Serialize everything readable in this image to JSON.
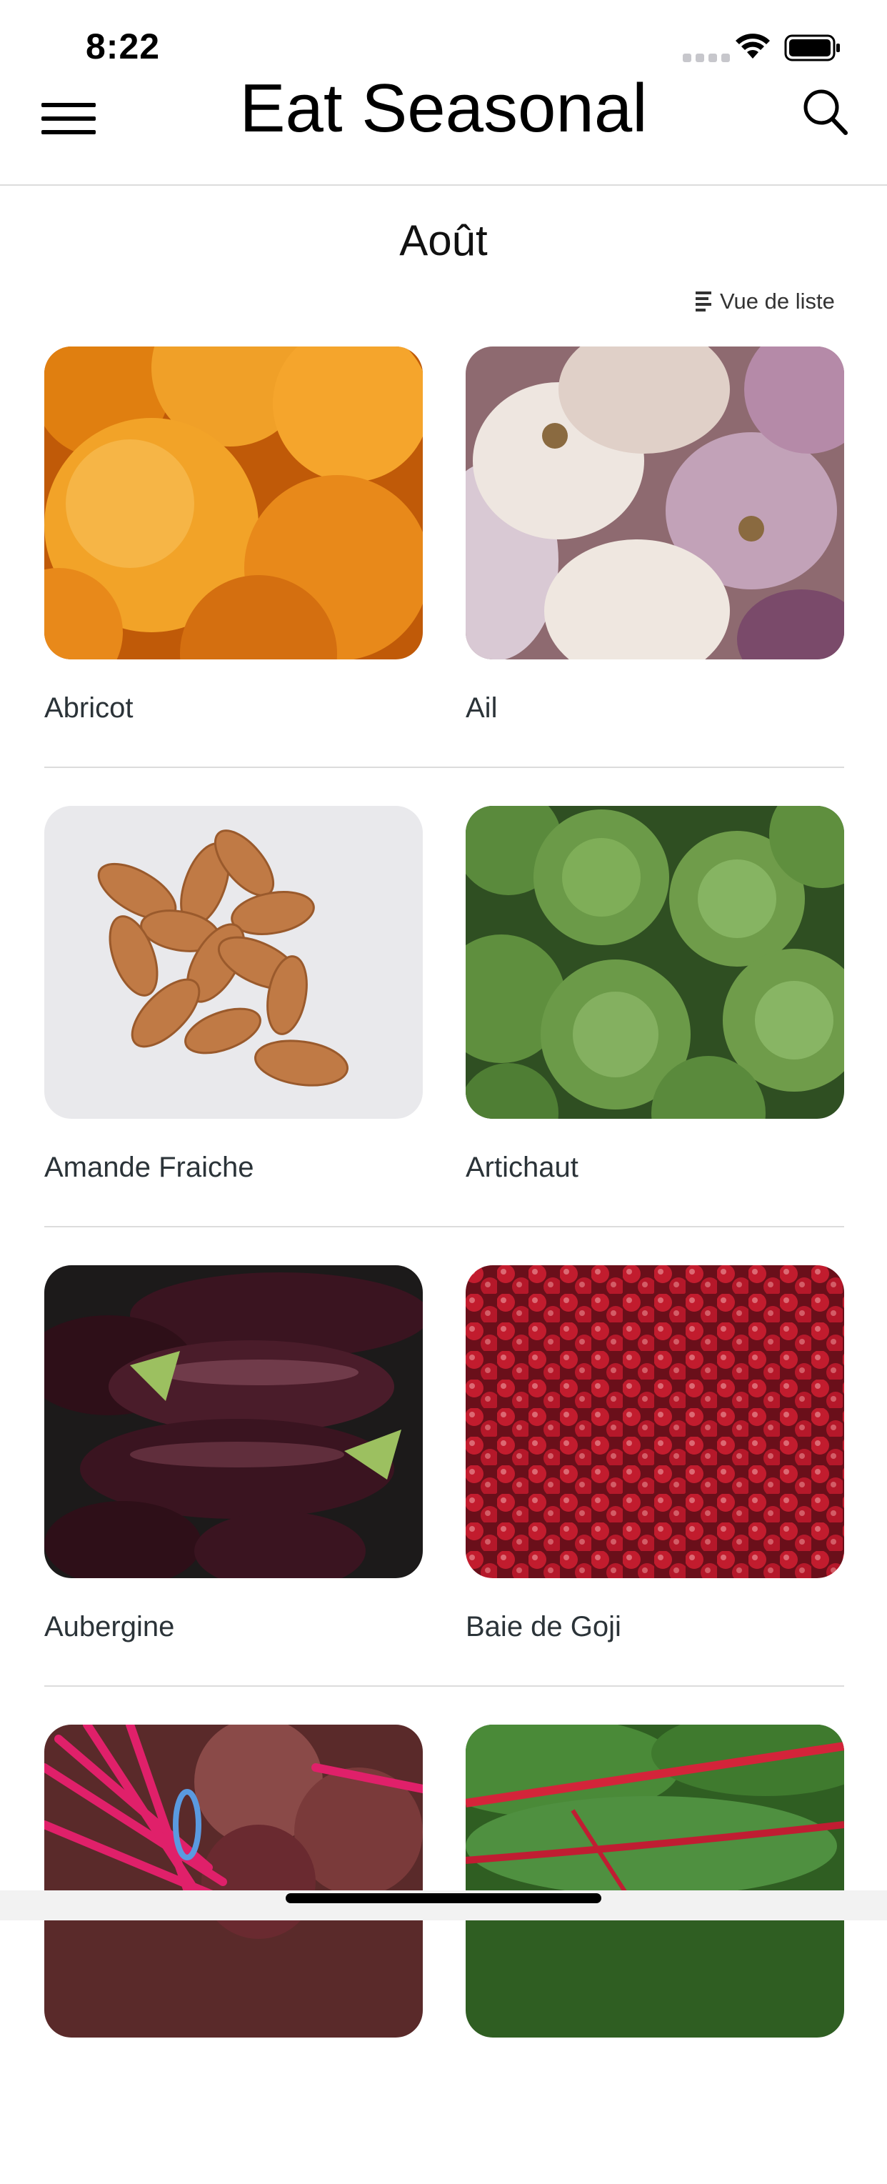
{
  "status_bar": {
    "time": "8:22"
  },
  "header": {
    "title": "Eat Seasonal",
    "menu_icon": "hamburger-menu-icon",
    "search_icon": "search-icon"
  },
  "month": "Août",
  "view_toggle": {
    "label": "Vue de liste",
    "icon": "list-icon"
  },
  "items": [
    {
      "name": "Abricot",
      "image": "apricot-photo"
    },
    {
      "name": "Ail",
      "image": "garlic-photo"
    },
    {
      "name": "Amande Fraiche",
      "image": "almond-photo"
    },
    {
      "name": "Artichaut",
      "image": "artichoke-photo"
    },
    {
      "name": "Aubergine",
      "image": "eggplant-photo"
    },
    {
      "name": "Baie de Goji",
      "image": "goji-berry-photo"
    },
    {
      "name": "",
      "image": "beetroot-photo"
    },
    {
      "name": "",
      "image": "chard-photo"
    }
  ],
  "colors": {
    "text": "#2b3338",
    "divider": "#dcdcdc",
    "apricot": "#e8891a",
    "garlic": "#e9dfd6",
    "almond": "#c07a45",
    "artichoke": "#5f8f3e",
    "eggplant": "#3a1420",
    "goji": "#b5182a",
    "beet": "#c2185b",
    "chard": "#3f7a2e"
  }
}
